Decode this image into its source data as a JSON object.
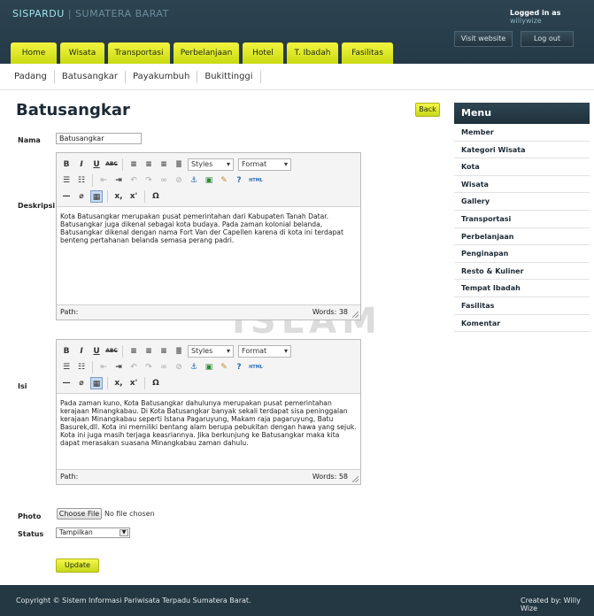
{
  "header": {
    "brand_part1": "SISPARDU",
    "brand_separator": "|",
    "brand_part2": "SUMATERA BARAT",
    "logged_in_prefix": "Logged in as",
    "logged_in_user": "willywize",
    "visit_website": "Visit website",
    "log_out": "Log out"
  },
  "nav": {
    "tabs": [
      {
        "label": "Home"
      },
      {
        "label": "Wisata"
      },
      {
        "label": "Transportasi"
      },
      {
        "label": "Perbelanjaan"
      },
      {
        "label": "Hotel"
      },
      {
        "label": "T. Ibadah"
      },
      {
        "label": "Fasilitas"
      }
    ]
  },
  "subnav": {
    "items": [
      "Padang",
      "Batusangkar",
      "Payakumbuh",
      "Bukittinggi"
    ]
  },
  "page": {
    "title": "Batusangkar",
    "back_label": "Back"
  },
  "form": {
    "nama_label": "Nama",
    "nama_value": "Batusangkar",
    "deskripsi_label": "Deskripsi",
    "isi_label": "Isi",
    "photo_label": "Photo",
    "status_label": "Status",
    "choose_file": "Choose File",
    "no_file": "No file chosen",
    "status_value": "Tampilkan",
    "update_label": "Update"
  },
  "editor_toolbar": {
    "bold": "B",
    "italic": "I",
    "underline": "U",
    "strike": "ABC",
    "styles": "Styles",
    "format": "Format",
    "html": "HTML",
    "subscript": "x,",
    "superscript": "x'",
    "omega": "Ω"
  },
  "deskripsi_editor": {
    "content": "Kota Batusangkar merupakan pusat pemerintahan dari Kabupaten Tanah Datar. Batusangkar juga dikenal sebagai kota budaya. Pada zaman kolonial belanda, Batusangkar  dikenal dengan nama Fort Van der Capellen karena di kota ini terdapat benteng pertahanan belanda  semasa perang padri.",
    "path_label": "Path:",
    "words": "Words: 38"
  },
  "isi_editor": {
    "content": "Pada zaman kuno, Kota Batusangkar dahulunya merupakan pusat pemerintahan kerajaan Minangkabau. Di Kota Batusangkar banyak sekali terdapat sisa peninggalan kerajaan Minangkabau seperti Istana Pagaruyung, Makam raja pagaruyung, Batu Basurek,dll. Kota ini memiliki bentang alam berupa pebukitan dengan hawa yang sejuk. Kota ini juga masih terjaga keasriannya. Jika berkunjung ke Batusangkar maka kita dapat merasakan suasana Minangkabau zaman dahulu.",
    "path_label": "Path:",
    "words": "Words: 58"
  },
  "sidebar": {
    "title": "Menu",
    "items": [
      "Member",
      "Kategori Wisata",
      "Kota",
      "Wisata",
      "Gallery",
      "Transportasi",
      "Perbelanjaan",
      "Penginapan",
      "Resto & Kuliner",
      "Tempat Ibadah",
      "Fasilitas",
      "Komentar"
    ]
  },
  "footer": {
    "copyright": "Copyright © Sistem Informasi Pariwisata Terpadu Sumatera Barat.",
    "created_by": "Created by: Willy Wize"
  },
  "colors": {
    "header_bg": "#2d4350",
    "tab_yellow": "#e8f02a",
    "brand_cyan": "#9fe4ec"
  }
}
